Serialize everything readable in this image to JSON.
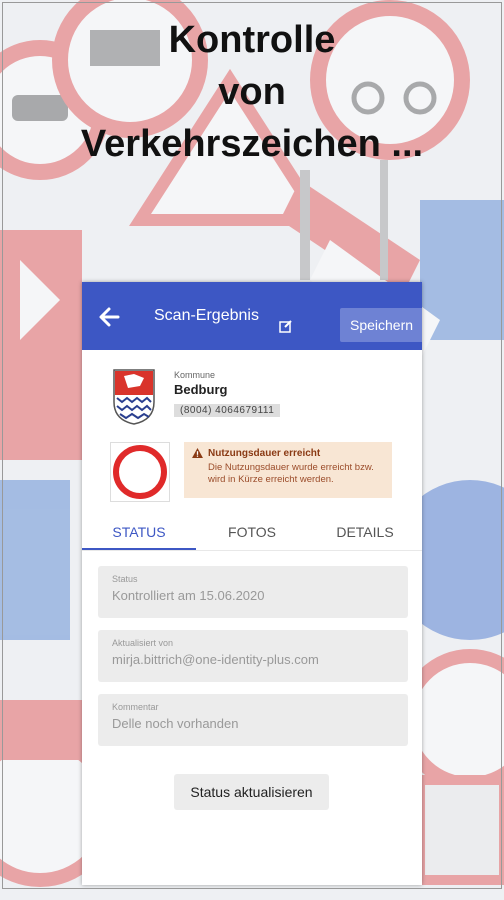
{
  "headline": {
    "line1": "Kontrolle",
    "line2": "von",
    "line3": "Verkehrszeichen ..."
  },
  "appbar": {
    "title": "Scan-Ergebnis",
    "save_label": "Speichern",
    "back_icon": "arrow-left-icon",
    "edit_icon": "edit-icon"
  },
  "kommune": {
    "label": "Kommune",
    "name": "Bedburg",
    "id": "(8004) 4064679111"
  },
  "warning": {
    "title": "Nutzungsdauer erreicht",
    "text": "Die Nutzungsdauer wurde erreicht bzw. wird in Kürze erreicht werden."
  },
  "tabs": [
    {
      "label": "STATUS",
      "active": true
    },
    {
      "label": "FOTOS",
      "active": false
    },
    {
      "label": "DETAILS",
      "active": false
    }
  ],
  "fields": {
    "status": {
      "label": "Status",
      "value": "Kontrolliert am 15.06.2020"
    },
    "updated_by": {
      "label": "Aktualisiert von",
      "value": "mirja.bittrich@one-identity-plus.com"
    },
    "comment": {
      "label": "Kommentar",
      "value": "Delle noch vorhanden"
    }
  },
  "actions": {
    "update_status_label": "Status aktualisieren"
  },
  "colors": {
    "accent": "#3d57c4",
    "warning_bg": "#f8e6d4",
    "warning_text": "#8a3a14",
    "sign_red": "#e02a2a"
  }
}
